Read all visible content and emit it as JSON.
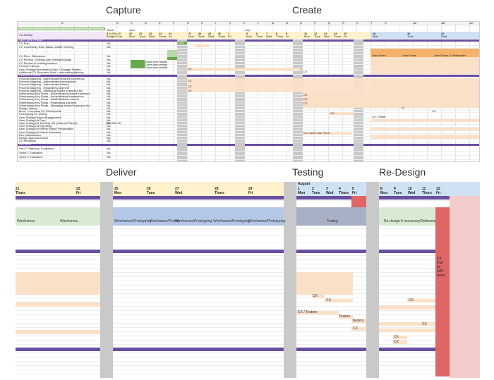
{
  "phases": {
    "capture": "Capture",
    "create": "Create",
    "deliver": "Deliver",
    "testing": "Testing",
    "redesign": "Re-Design"
  },
  "colors": {
    "purple": "#6a4fa0",
    "grey_column": "#c9c9c9",
    "peach": "#fbe0c8",
    "light_green": "#d9ead3",
    "green": "#6aa84f",
    "lilac": "#b4c7e7",
    "lavender": "#d9d2e9",
    "light_blue": "#cfe2f3",
    "yellow": "#fff2cc",
    "red": "#e06666",
    "pink": "#f4cccc",
    "orange": "#f6b26b"
  },
  "top_sheet": {
    "column_letters": [
      "A",
      "B",
      "C",
      "D",
      "E",
      "F",
      "G",
      "H",
      "I",
      "J",
      "K",
      "L",
      "M",
      "N",
      "O",
      "P",
      "Q",
      "R",
      "S",
      "T",
      "U",
      "V",
      "W",
      "X",
      "Y",
      "Z",
      "AA",
      "AB",
      "AC"
    ],
    "header_labels": {
      "activity": "CX Activity",
      "week_ending": "Week",
      "budget_label": "$10,000.00",
      "budget_sub": "Budget Cost",
      "june": "June",
      "july": "July"
    },
    "date_cells": [
      "20",
      "21",
      "22",
      "23",
      "24",
      "27",
      "28",
      "29",
      "30",
      "1",
      "5",
      "6",
      "7",
      "8",
      "9",
      "11",
      "12",
      "13",
      "14",
      "15",
      "18",
      "19",
      "20"
    ],
    "day_cells": [
      "Mon",
      "Tues",
      "Wed",
      "Thurs",
      "Fri",
      "Mon",
      "Tues",
      "Wed",
      "Thurs",
      "Fri",
      "Mon",
      "Tues",
      "Wed",
      "Thurs",
      "Fri",
      "Mon",
      "Tues",
      "Wed",
      "Thurs",
      "Fri",
      "Mon",
      "Tues",
      "Wed"
    ],
    "section_capture": "CAPTURE PHASE",
    "section_create": "CREATE PHASE",
    "section_deliver": "DELIVER",
    "rows_capture": [
      "CX Plan",
      "CX Leadership team status update meeting",
      "",
      "",
      "CX Plan - Milestones",
      "CX Review - Existing user testing findings",
      "CX Review of existing solution",
      "Product Canvas",
      "User Testing Recruitment Spec + Engage Testers",
      "Additional CX Resource Start + onboarding/backlog"
    ],
    "rows_create": [
      "Process Mapping - Authenticated shared experience",
      "Process Mapping - Authenticated transactions",
      "Process Mapping - Authenticated library",
      "Process Mapping - Requesting payment",
      "Process Mapping - Managing shared expenses list",
      "Wireframing Key Flows - Authenticated shared expenses",
      "Wireframing Key Flows - Authenticated transactions",
      "Wireframing Key Flows - Add/Edit/delete friends",
      "Wireframing Key Flows - Requesting payment",
      "Wireframing Key Flows - Managing shared expenses list",
      "Design Library",
      "MoJo / Compass CX Checkpoints",
      "Prototyping for Testing",
      "User Testing Project Engagement",
      "User Testing Kit Prep",
      "User Testing Kit Test Day 4/6 (Harbour/Fitzrolf)",
      "User Testing Kit Reporting",
      "User Testing Kit Retest Report Presentation",
      "User Testing Kit Retest Revisions",
      "Dev collaboration",
      "Design Approval Board",
      "CX Revisions"
    ],
    "rows_deliver": [
      "Pre-IT Planning / Evaluation",
      "Sprint 1 Evaluation",
      "Sprint 2 Evaluation"
    ],
    "na": "NA",
    "budget_value": "$10,000.00",
    "cell_notes": {
      "done": "Done",
      "cx": "CX",
      "done_prev": "Done prev mostly",
      "user_tester": "CX / Testers",
      "cx_tester": "CX / Tester",
      "user_roles": "User Roles",
      "user_flows": "User Flows",
      "user_flows_wf": "User Flows & Wireframes",
      "cx_tester_ba": "CX / Auth / BA / Prod"
    }
  },
  "bottom_sheet": {
    "dates": [
      {
        "num": "21",
        "day": "Thurs"
      },
      {
        "num": "22",
        "day": "Fri"
      },
      {
        "num": "25",
        "day": "Mon"
      },
      {
        "num": "26",
        "day": "Tues"
      },
      {
        "num": "27",
        "day": "Wed"
      },
      {
        "num": "28",
        "day": "Thurs"
      },
      {
        "num": "29",
        "day": "Fri"
      }
    ],
    "august": "August",
    "aug_dates": [
      {
        "num": "1",
        "day": "Mon"
      },
      {
        "num": "2",
        "day": "Tues"
      },
      {
        "num": "3",
        "day": "Wed"
      },
      {
        "num": "4",
        "day": "Thurs"
      },
      {
        "num": "5",
        "day": "Fri"
      }
    ],
    "aug_dates2": [
      {
        "num": "8",
        "day": "Mon"
      },
      {
        "num": "9",
        "day": "Tues"
      },
      {
        "num": "10",
        "day": "Wed"
      },
      {
        "num": "11",
        "day": "Thurs"
      },
      {
        "num": "12",
        "day": "Fri"
      }
    ],
    "wireframes": "Wireframes",
    "wireframes2": "Wireframes",
    "wf_proto": [
      "Wireframes/Prototyping",
      "Wireframes/Prototy",
      "Wireframes/Prototyping",
      "Wireframes/Prototyping",
      "Wireframes/Prototyping"
    ],
    "testing": "Testing",
    "redesign_note": "Re-design if necessary/Refinement",
    "cx_due": "CX Due for UAT team",
    "notes": {
      "cx1": "CX",
      "cx2": "CX",
      "cx3": "CX",
      "cx_testers": "CX / Testers",
      "testers1": "Testers",
      "testers2": "Testers",
      "cx4": "CX",
      "cx5": "CX",
      "cx6": "CX",
      "cx7": "CX"
    }
  }
}
